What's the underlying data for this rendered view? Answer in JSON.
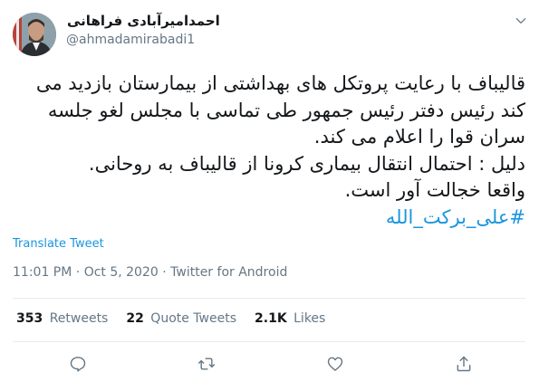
{
  "author": {
    "name": "احمدامیرآبادی فراهانی",
    "handle": "@ahmadamirabadi1"
  },
  "tweet": {
    "lines": [
      "قالیباف با رعایت پروتکل های بهداشتی از بیمارستان بازدید می",
      "کند رئیس دفتر رئیس جمهور طی تماسی با مجلس لغو جلسه",
      "سران قوا را اعلام می کند.",
      "دلیل : احتمال انتقال بیماری کرونا از قالیباف به روحانی.",
      "واقعا خجالت آور است."
    ],
    "hashtag": "#علی_برکت_الله"
  },
  "translate_label": "Translate Tweet",
  "meta": {
    "time": "11:01 PM",
    "separator1": "·",
    "date": "Oct 5, 2020",
    "separator2": "·",
    "source": "Twitter for Android"
  },
  "stats": {
    "retweets_count": "353",
    "retweets_label": "Retweets",
    "quotes_count": "22",
    "quotes_label": "Quote Tweets",
    "likes_count": "2.1K",
    "likes_label": "Likes"
  },
  "icons": {
    "caret": "chevron-down-icon",
    "reply": "reply-icon",
    "retweet": "retweet-icon",
    "like": "heart-icon",
    "share": "share-icon"
  },
  "colors": {
    "link": "#1b95e0",
    "secondary_text": "#657786",
    "divider": "#e6ecf0",
    "icon": "#657786"
  }
}
